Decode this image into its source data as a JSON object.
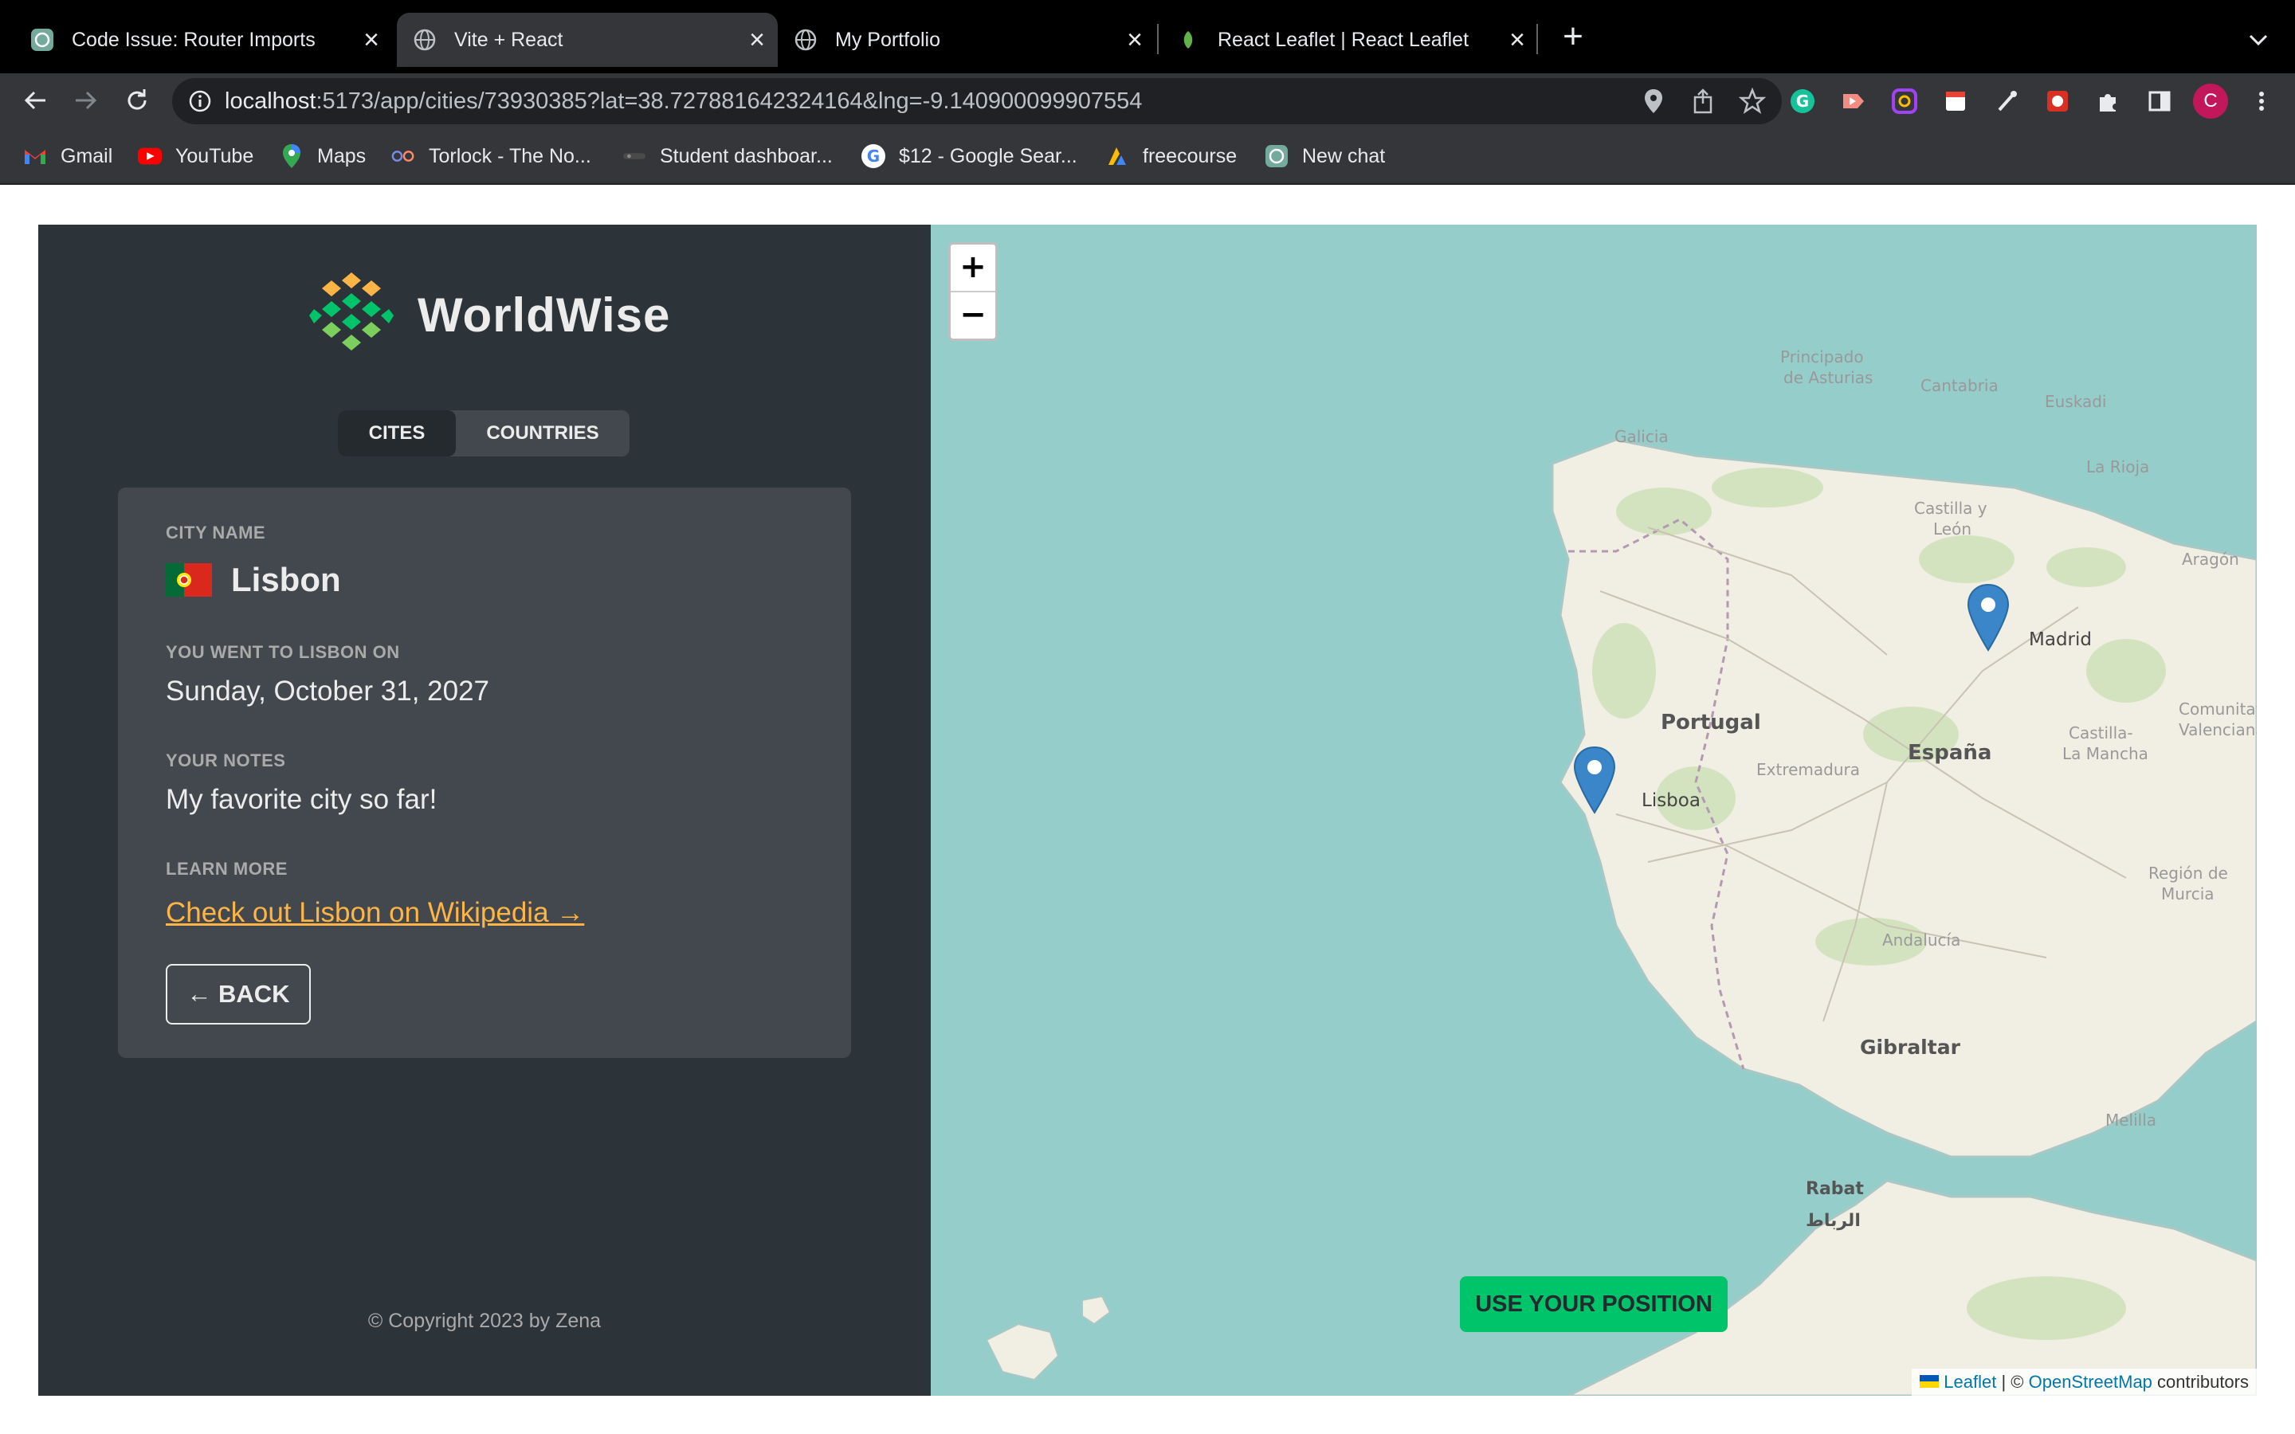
{
  "browser": {
    "tabs": [
      {
        "title": "Code Issue: Router Imports",
        "icon": "openai-icon",
        "active": false
      },
      {
        "title": "Vite + React",
        "icon": "globe-icon",
        "active": true
      },
      {
        "title": "My Portfolio",
        "icon": "globe-icon",
        "active": false
      },
      {
        "title": "React Leaflet | React Leaflet",
        "icon": "leaf-icon",
        "active": false
      }
    ],
    "url_host": "localhost",
    "url_rest": ":5173/app/cities/73930385?lat=38.727881642324164&lng=-9.140900099907554",
    "profile_initial": "C",
    "bookmarks": [
      {
        "label": "Gmail",
        "icon": "gmail-icon"
      },
      {
        "label": "YouTube",
        "icon": "youtube-icon"
      },
      {
        "label": "Maps",
        "icon": "maps-pin-icon"
      },
      {
        "label": "Torlock - The No...",
        "icon": "torlock-icon"
      },
      {
        "label": "Student dashboar...",
        "icon": "student-icon"
      },
      {
        "label": "$12 - Google Sear...",
        "icon": "google-icon"
      },
      {
        "label": "freecourse",
        "icon": "freecourse-icon"
      },
      {
        "label": "New chat",
        "icon": "openai-icon"
      }
    ]
  },
  "sidebar": {
    "logo_text": "WorldWise",
    "tabs": [
      {
        "label": "CITES",
        "active": true
      },
      {
        "label": "COUNTRIES",
        "active": false
      }
    ],
    "city": {
      "name_label": "City name",
      "flag": "portugal-flag",
      "name": "Lisbon",
      "date_label": "You went to Lisbon on",
      "date": "Sunday, October 31, 2027",
      "notes_label": "Your notes",
      "notes": "My favorite city so far!",
      "learn_label": "Learn more",
      "wiki_link": "Check out Lisbon on Wikipedia →",
      "back_button": "← BACK"
    },
    "copyright": "© Copyright 2023 by Zena"
  },
  "map": {
    "zoom_in": "+",
    "zoom_out": "−",
    "labels": {
      "asturias_1": "Principado",
      "asturias_2": "de Asturias",
      "cantabria": "Cantabria",
      "euskadi": "Euskadi",
      "galicia": "Galicia",
      "larioja": "La Rioja",
      "castilla_leon_1": "Castilla y",
      "castilla_leon_2": "León",
      "aragon": "Aragón",
      "madrid": "Madrid",
      "portugal": "Portugal",
      "espana": "España",
      "extremadura": "Extremadura",
      "castilla_mancha_1": "Castilla-",
      "castilla_mancha_2": "La Mancha",
      "valenciana_1": "Comunitat",
      "valenciana_2": "Valenciana",
      "lisboa": "Lisboa",
      "murcia_1": "Región de",
      "murcia_2": "Murcia",
      "andalucia": "Andalucía",
      "gibraltar": "Gibraltar",
      "melilla": "Melilla",
      "rabat": "Rabat",
      "rabat_ar": "الرباط"
    },
    "markers": [
      "Madrid",
      "Lisboa"
    ],
    "use_position_button": "USE YOUR POSITION",
    "attribution_leaflet": "Leaflet",
    "attribution_sep": "| ©",
    "attribution_osm": "OpenStreetMap",
    "attribution_tail": "contributors"
  },
  "colors": {
    "sidebar_bg": "#2d3439",
    "card_bg": "#42484d",
    "accent_link": "#ffb545",
    "button_green": "#00c46a",
    "sea": "#95cdca",
    "land": "#f1eee4"
  }
}
